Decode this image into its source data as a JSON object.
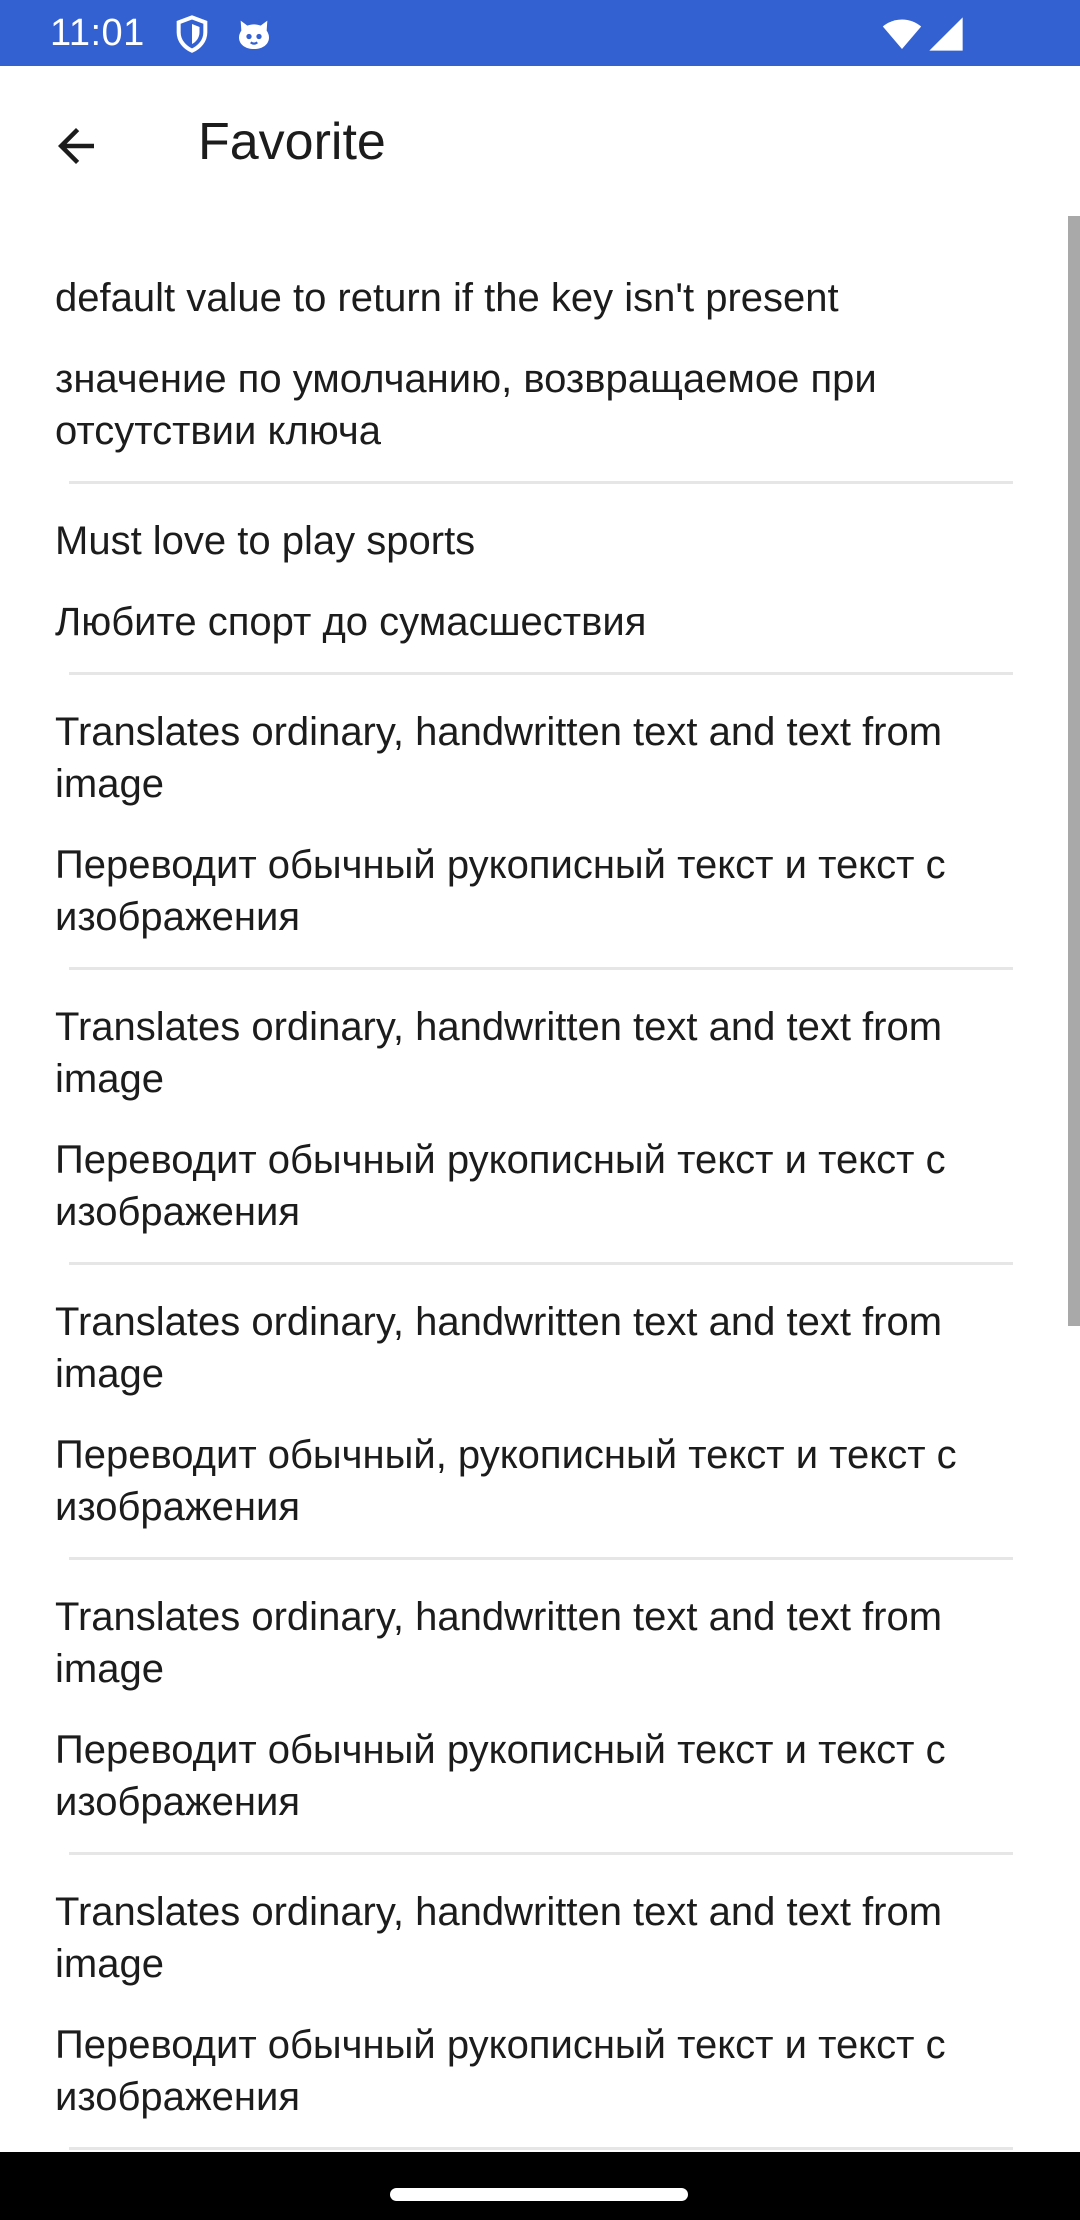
{
  "status_bar": {
    "time": "11:01",
    "color": "#3461d1",
    "icons": [
      "shield-icon",
      "cat-face-icon",
      "wifi-icon",
      "signal-icon"
    ]
  },
  "app_bar": {
    "title": "Favorite",
    "back_icon": "arrow-back-icon"
  },
  "entries": [
    {
      "source": "default value to return if the key isn't present",
      "translation": "значение по умолчанию, возвращаемое при отсутствии ключа"
    },
    {
      "source": "Must love to play sports",
      "translation": "Любите спорт до сумасшествия"
    },
    {
      "source": "Translates ordinary, handwritten text and text from image",
      "translation": "Переводит обычный рукописный текст и текст с изображения"
    },
    {
      "source": "Translates ordinary, handwritten text and text from image",
      "translation": "Переводит обычный рукописный текст и текст с изображения"
    },
    {
      "source": "Translates ordinary, handwritten text and text from image",
      "translation": "Переводит обычный, рукописный текст и текст с изображения"
    },
    {
      "source": "Translates ordinary, handwritten text and text from image",
      "translation": "Переводит обычный рукописный текст и текст с изображения"
    },
    {
      "source": "Translates ordinary, handwritten text and text from image",
      "translation": "Переводит обычный рукописный текст и текст с изображения"
    }
  ]
}
